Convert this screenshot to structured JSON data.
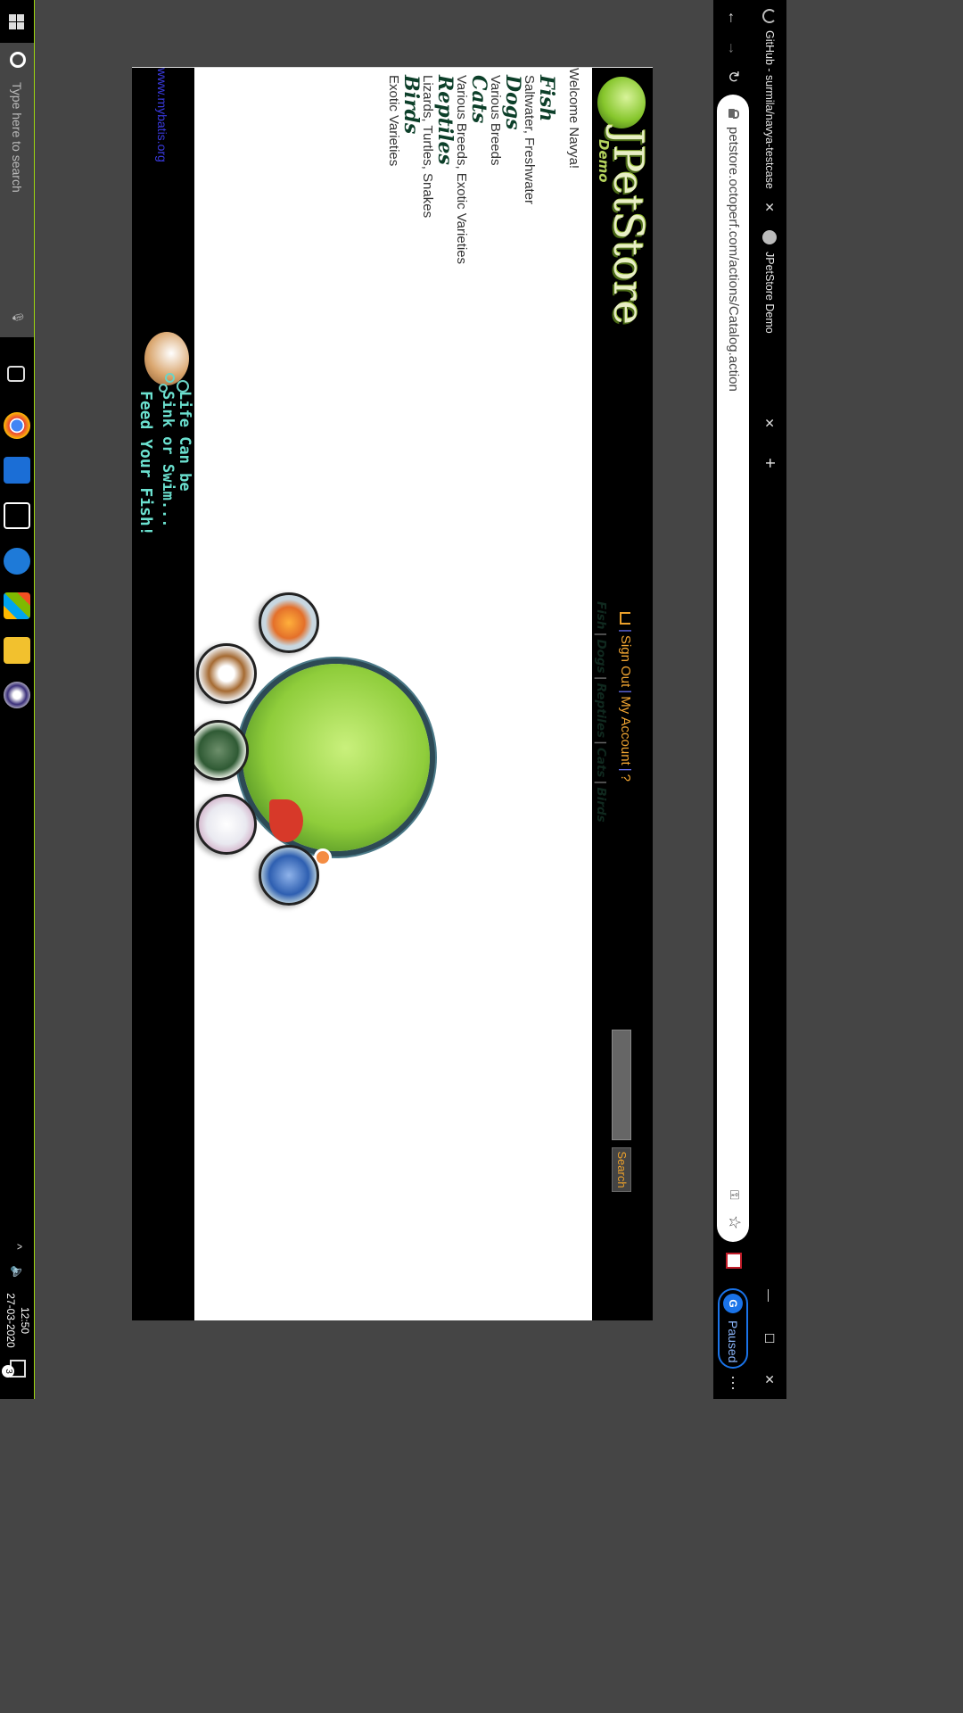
{
  "browser": {
    "tabs": [
      {
        "title": "GitHub - surmila/navya-testcase",
        "active": false
      },
      {
        "title": "JPetStore Demo",
        "active": true
      }
    ],
    "url": "petstore.octoperf.com/actions/Catalog.action",
    "profile_initial": "G",
    "profile_status": "Paused",
    "accent_color": "#1a73e8"
  },
  "site": {
    "logo_title": "JPetStore",
    "logo_subtitle": "Demo",
    "menu": {
      "sign_out": "Sign Out",
      "my_account": "My Account",
      "help": "?"
    },
    "quicklinks": [
      "Fish",
      "Dogs",
      "Reptiles",
      "Cats",
      "Birds"
    ],
    "search_button": "Search",
    "search_value": ""
  },
  "sidebar": {
    "welcome": "Welcome Navya!",
    "categories": [
      {
        "title": "Fish",
        "desc": "Saltwater, Freshwater"
      },
      {
        "title": "Dogs",
        "desc": "Various Breeds"
      },
      {
        "title": "Cats",
        "desc": "Various Breeds, Exotic Varieties"
      },
      {
        "title": "Reptiles",
        "desc": "Lizards, Turtles, Snakes"
      },
      {
        "title": "Birds",
        "desc": "Exotic Varieties"
      }
    ]
  },
  "footer": {
    "link": "www.mybatis.org",
    "banner_line1": "Life Can be",
    "banner_line2": "Sink or Swim...",
    "banner_line3": "Feed Your Fish!"
  },
  "taskbar": {
    "search_placeholder": "Type here to search",
    "time": "12:50",
    "date": "27-03-2020",
    "notifications": "3"
  }
}
